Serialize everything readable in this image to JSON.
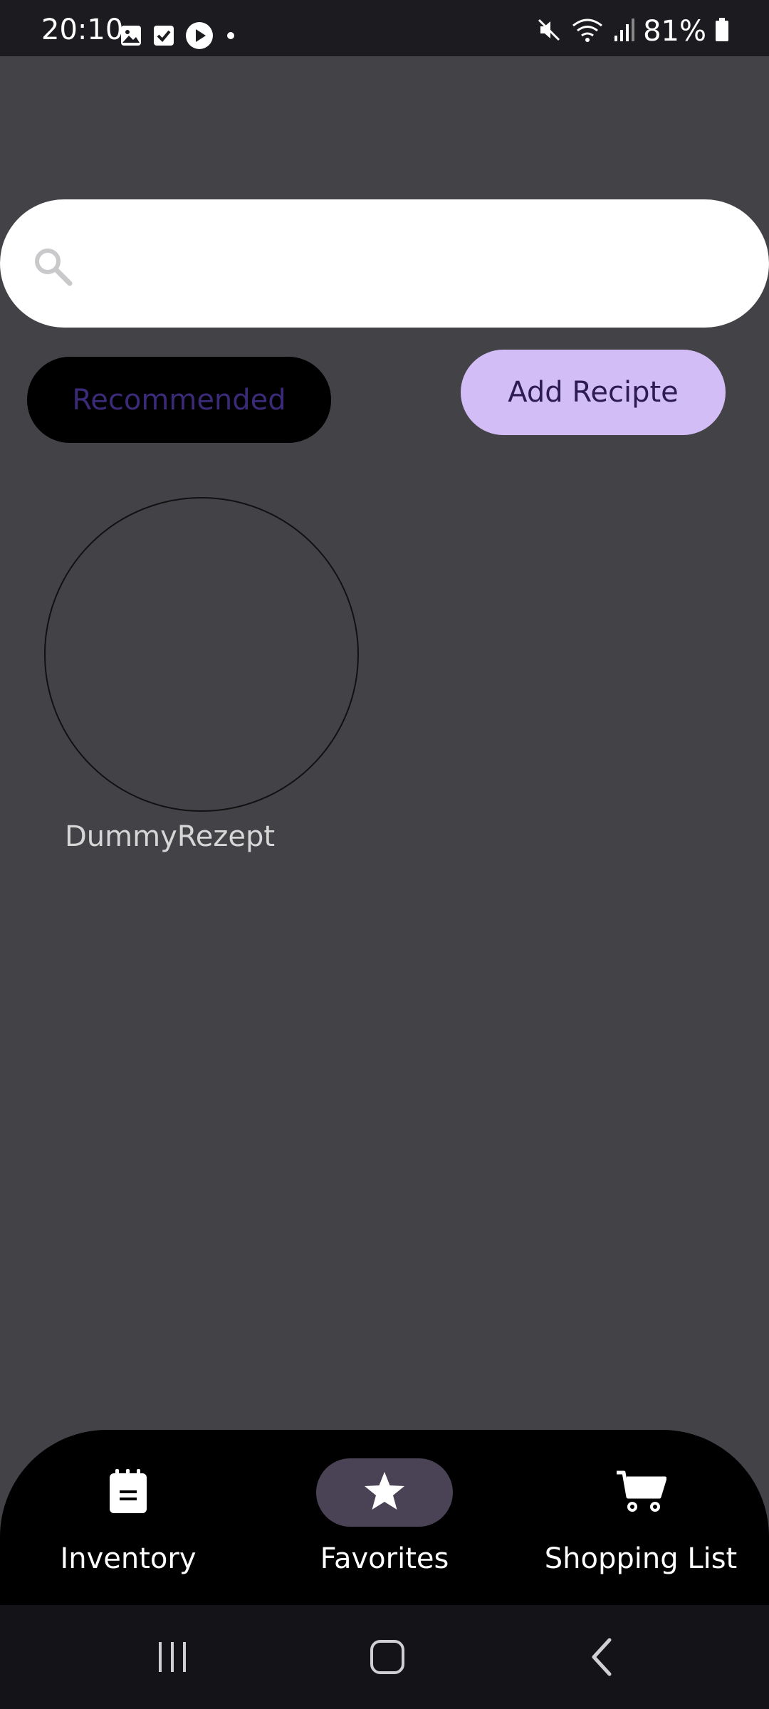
{
  "status_bar": {
    "time": "20:10",
    "battery": "81%",
    "icons_left": [
      "image-icon",
      "checkbox-icon",
      "play-icon",
      "dot-icon"
    ],
    "icons_right": [
      "mute-icon",
      "wifi-icon",
      "signal-icon",
      "battery-icon"
    ]
  },
  "search": {
    "placeholder": "",
    "value": ""
  },
  "buttons": {
    "recommended": "Recommended",
    "add_recipe": "Add Recipte"
  },
  "recipes": [
    {
      "name": "DummyRezept"
    }
  ],
  "bottom_nav": {
    "items": [
      {
        "label": "Inventory",
        "icon": "notepad-icon",
        "active": false
      },
      {
        "label": "Favorites",
        "icon": "star-icon",
        "active": true
      },
      {
        "label": "Shopping List",
        "icon": "cart-icon",
        "active": false
      }
    ]
  },
  "colors": {
    "background": "#434247",
    "accent": "#d2bdf7",
    "nav_active": "#4a4356"
  }
}
